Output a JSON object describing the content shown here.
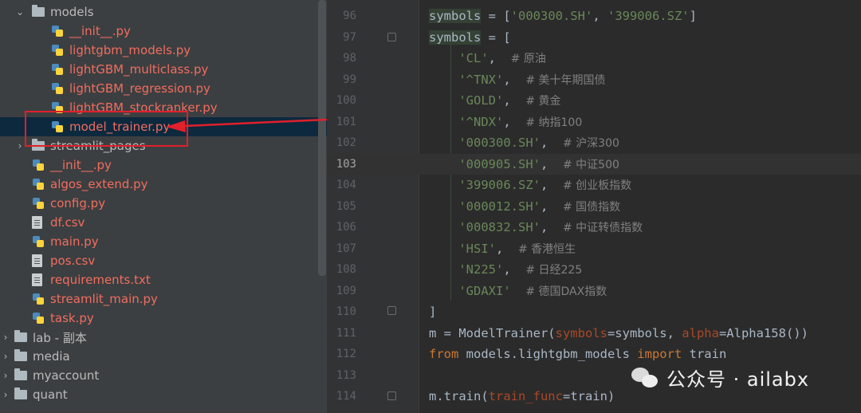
{
  "colors": {
    "tree_bg": "#3c3f41",
    "editor_bg": "#2b2b2b",
    "file_red": "#f16d5f",
    "selection": "#0d293e",
    "annotation_red": "#e0202b"
  },
  "tree": {
    "items": [
      {
        "label": "models",
        "kind": "folder",
        "expanded": true,
        "icon": "folder-icon"
      },
      {
        "label": "__init__.py",
        "kind": "python-file",
        "icon": "python-file-icon"
      },
      {
        "label": "lightgbm_models.py",
        "kind": "python-file",
        "icon": "python-file-icon"
      },
      {
        "label": "lightGBM_multiclass.py",
        "kind": "python-file",
        "icon": "python-file-icon"
      },
      {
        "label": "lightGBM_regression.py",
        "kind": "python-file",
        "icon": "python-file-icon"
      },
      {
        "label": "lightGBM_stockranker.py",
        "kind": "python-file",
        "icon": "python-file-icon"
      },
      {
        "label": "model_trainer.py",
        "kind": "python-file",
        "selected": true,
        "icon": "python-file-icon"
      },
      {
        "label": "streamlit_pages",
        "kind": "folder",
        "expanded": false,
        "icon": "folder-icon"
      },
      {
        "label": "__init__.py",
        "kind": "python-file",
        "icon": "python-file-icon"
      },
      {
        "label": "algos_extend.py",
        "kind": "python-file",
        "icon": "python-file-icon"
      },
      {
        "label": "config.py",
        "kind": "python-file",
        "icon": "python-file-icon"
      },
      {
        "label": "df.csv",
        "kind": "file",
        "icon": "text-file-icon"
      },
      {
        "label": "main.py",
        "kind": "python-file",
        "icon": "python-file-icon"
      },
      {
        "label": "pos.csv",
        "kind": "file",
        "icon": "text-file-icon"
      },
      {
        "label": "requirements.txt",
        "kind": "file",
        "icon": "text-file-icon"
      },
      {
        "label": "streamlit_main.py",
        "kind": "python-file",
        "icon": "python-file-icon"
      },
      {
        "label": "task.py",
        "kind": "python-file",
        "icon": "python-file-icon"
      },
      {
        "label": "lab - 副本",
        "kind": "folder",
        "expanded": false,
        "icon": "folder-icon"
      },
      {
        "label": "media",
        "kind": "folder",
        "expanded": false,
        "icon": "folder-icon"
      },
      {
        "label": "myaccount",
        "kind": "folder",
        "expanded": false,
        "icon": "folder-icon"
      },
      {
        "label": "quant",
        "kind": "folder",
        "expanded": false,
        "icon": "folder-icon"
      }
    ]
  },
  "editor": {
    "current_line": "103",
    "lines": [
      {
        "num": "96",
        "segs": [
          {
            "t": "symbols",
            "c": "hl"
          },
          {
            "t": " = ["
          },
          {
            "t": "'000300.SH'",
            "c": "str"
          },
          {
            "t": ", "
          },
          {
            "t": "'399006.SZ'",
            "c": "str"
          },
          {
            "t": "]"
          }
        ]
      },
      {
        "num": "97",
        "segs": [
          {
            "t": "symbols",
            "c": "hl"
          },
          {
            "t": " = ["
          }
        ]
      },
      {
        "num": "98",
        "segs": [
          {
            "t": "    "
          },
          {
            "t": "'CL'",
            "c": "str"
          },
          {
            "t": ",  "
          },
          {
            "t": "# 原油",
            "c": "com"
          }
        ]
      },
      {
        "num": "99",
        "segs": [
          {
            "t": "    "
          },
          {
            "t": "'^TNX'",
            "c": "str"
          },
          {
            "t": ",  "
          },
          {
            "t": "# 美十年期国债",
            "c": "com"
          }
        ]
      },
      {
        "num": "100",
        "segs": [
          {
            "t": "    "
          },
          {
            "t": "'GOLD'",
            "c": "str"
          },
          {
            "t": ",  "
          },
          {
            "t": "# 黄金",
            "c": "com"
          }
        ]
      },
      {
        "num": "101",
        "segs": [
          {
            "t": "    "
          },
          {
            "t": "'^NDX'",
            "c": "str"
          },
          {
            "t": ",  "
          },
          {
            "t": "# 纳指100",
            "c": "com"
          }
        ]
      },
      {
        "num": "102",
        "segs": [
          {
            "t": "    "
          },
          {
            "t": "'000300.SH'",
            "c": "str"
          },
          {
            "t": ",  "
          },
          {
            "t": "# 沪深300",
            "c": "com"
          }
        ]
      },
      {
        "num": "103",
        "segs": [
          {
            "t": "    "
          },
          {
            "t": "'000905.SH'",
            "c": "str"
          },
          {
            "t": ",  "
          },
          {
            "t": "# 中证500",
            "c": "com"
          }
        ]
      },
      {
        "num": "104",
        "segs": [
          {
            "t": "    "
          },
          {
            "t": "'399006.SZ'",
            "c": "str"
          },
          {
            "t": ",  "
          },
          {
            "t": "# 创业板指数",
            "c": "com"
          }
        ]
      },
      {
        "num": "105",
        "segs": [
          {
            "t": "    "
          },
          {
            "t": "'000012.SH'",
            "c": "str"
          },
          {
            "t": ",  "
          },
          {
            "t": "# 国债指数",
            "c": "com"
          }
        ]
      },
      {
        "num": "106",
        "segs": [
          {
            "t": "    "
          },
          {
            "t": "'000832.SH'",
            "c": "str"
          },
          {
            "t": ",  "
          },
          {
            "t": "# 中证转债指数",
            "c": "com"
          }
        ]
      },
      {
        "num": "107",
        "segs": [
          {
            "t": "    "
          },
          {
            "t": "'HSI'",
            "c": "str"
          },
          {
            "t": ",  "
          },
          {
            "t": "# 香港恒生",
            "c": "com"
          }
        ]
      },
      {
        "num": "108",
        "segs": [
          {
            "t": "    "
          },
          {
            "t": "'N225'",
            "c": "str"
          },
          {
            "t": ",  "
          },
          {
            "t": "# 日经225",
            "c": "com"
          }
        ]
      },
      {
        "num": "109",
        "segs": [
          {
            "t": "    "
          },
          {
            "t": "'GDAXI'",
            "c": "str"
          },
          {
            "t": "  "
          },
          {
            "t": "# 德国DAX指数",
            "c": "com"
          }
        ]
      },
      {
        "num": "110",
        "segs": [
          {
            "t": "]"
          }
        ]
      },
      {
        "num": "111",
        "segs": [
          {
            "t": "m = ModelTrainer("
          },
          {
            "t": "symbols",
            "c": "param"
          },
          {
            "t": "=symbols, "
          },
          {
            "t": "alpha",
            "c": "param"
          },
          {
            "t": "=Alpha158())"
          }
        ]
      },
      {
        "num": "112",
        "segs": [
          {
            "t": "from",
            "c": "kw"
          },
          {
            "t": " models.lightgbm_models "
          },
          {
            "t": "import",
            "c": "kw"
          },
          {
            "t": " train"
          }
        ]
      },
      {
        "num": "113",
        "segs": []
      },
      {
        "num": "114",
        "segs": [
          {
            "t": "m.train("
          },
          {
            "t": "train_func",
            "c": "param"
          },
          {
            "t": "=train)"
          }
        ]
      }
    ]
  },
  "watermark": {
    "text": "公众号 · ailabx",
    "icon": "wechat-icon"
  },
  "annotation": {
    "arrow_icon": "red-arrow-icon",
    "box": "highlight-box"
  }
}
